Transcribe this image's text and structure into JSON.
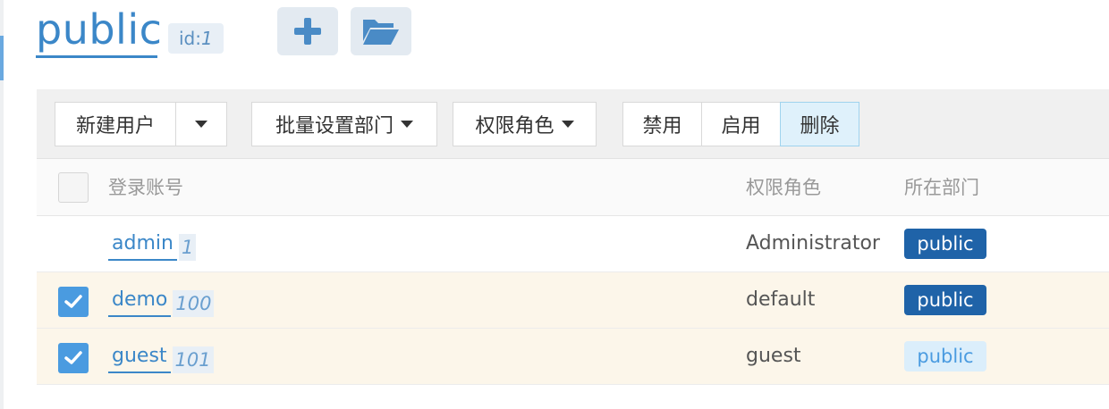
{
  "header": {
    "title": "public",
    "id_label": "id:",
    "id_value": "1",
    "add_icon": "plus-icon",
    "folder_icon": "folder-open-icon"
  },
  "toolbar": {
    "new_user": "新建用户",
    "batch_dept": "批量设置部门",
    "role": "权限角色",
    "disable": "禁用",
    "enable": "启用",
    "delete": "删除"
  },
  "table": {
    "columns": [
      "登录账号",
      "权限角色",
      "所在部门"
    ],
    "rows": [
      {
        "account": "admin",
        "id": "1",
        "role": "Administrator",
        "dept": "public",
        "checked": false
      },
      {
        "account": "demo",
        "id": "100",
        "role": "default",
        "dept": "public",
        "checked": true
      },
      {
        "account": "guest",
        "id": "101",
        "role": "guest",
        "dept": "public",
        "checked": true
      }
    ]
  },
  "colors": {
    "accent": "#3b87c8",
    "dept_dark": "#1f63a8",
    "dept_light": "#dbeefb",
    "checkbox": "#4a9be0",
    "selected_row": "#fcf6ea"
  }
}
